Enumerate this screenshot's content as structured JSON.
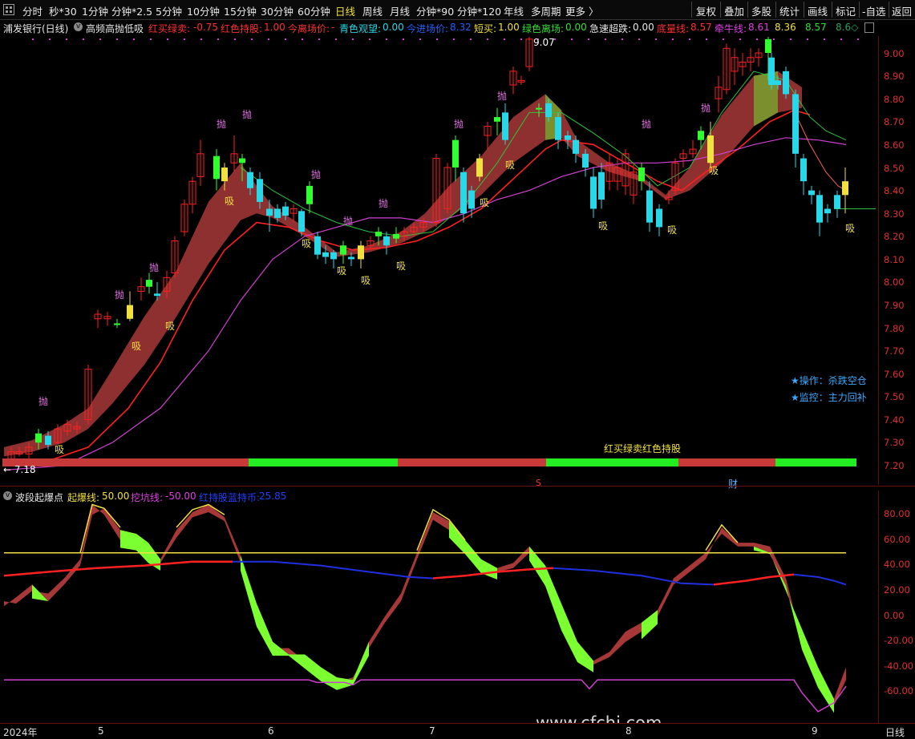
{
  "toolbar": {
    "periods": [
      "分时",
      "秒*30",
      "1分钟",
      "分钟*2.5",
      "5分钟",
      "10分钟",
      "15分钟",
      "30分钟",
      "60分钟",
      "日线",
      "周线",
      "月线",
      "分钟*90",
      "分钟*120",
      "年线",
      "多周期",
      "更多 〉"
    ],
    "active_period": "日线",
    "right_buttons": [
      "复权",
      "叠加",
      "多股",
      "统计",
      "画线",
      "标记",
      "-自选",
      "返回"
    ]
  },
  "main_info": {
    "stock": "浦发银行(日线)",
    "indicator_name": "高频高抛低吸",
    "items": [
      {
        "label": "红买绿卖:",
        "value": "-0.75",
        "color": "#ff3030"
      },
      {
        "label": "红色持股:",
        "value": "1.00",
        "color": "#ff3030"
      },
      {
        "label": "今离场价:",
        "value": "-",
        "color": "#ff3030"
      },
      {
        "label": "青色观望:",
        "value": "0.00",
        "color": "#28d8e8"
      },
      {
        "label": "今进场价:",
        "value": "8.32",
        "color": "#2060ff"
      },
      {
        "label": "短买:",
        "value": "1.00",
        "color": "#f0e040"
      },
      {
        "label": "绿色离场:",
        "value": "0.00",
        "color": "#30e030"
      },
      {
        "label": "急速超跌:",
        "value": "0.00",
        "color": "#e8e8e8"
      },
      {
        "label": "底量线:",
        "value": "8.57",
        "color": "#ff3030"
      },
      {
        "label": "牵牛线:",
        "value": "8.61",
        "color": "#e040e0"
      },
      {
        "label": "",
        "value": "8.36",
        "color": "#f0e040"
      },
      {
        "label": "",
        "value": "8.57",
        "color": "#30e030"
      },
      {
        "label": "",
        "value": "8.6◇",
        "color": "#2aa060"
      }
    ]
  },
  "price_axis": [
    "9.00",
    "8.90",
    "8.80",
    "8.70",
    "8.60",
    "8.50",
    "8.40",
    "8.30",
    "8.20",
    "8.10",
    "8.00",
    "7.90",
    "7.80",
    "7.70",
    "7.60",
    "7.50",
    "7.40",
    "7.30",
    "7.20"
  ],
  "annotations": {
    "high_marker": "9.07",
    "low_marker": "← 7.18",
    "ops": "★操作：杀跌空仓",
    "monitor": "★监控：主力回补",
    "band_label": "红买绿卖红色持股",
    "s_mark": "S",
    "cai_mark": "财",
    "throw": "抛",
    "absorb": "吸"
  },
  "ind_info": {
    "name": "波段起爆点",
    "items": [
      {
        "label": "起爆线:",
        "value": "50.00",
        "color": "#f0e040"
      },
      {
        "label": "挖坑线:",
        "value": "-50.00",
        "color": "#e040e0"
      },
      {
        "label": "红持股蓝持币:",
        "value": "25.85",
        "color": "#2040ff"
      }
    ]
  },
  "ind_axis": [
    "80.00",
    "60.00",
    "40.00",
    "20.00",
    "0.00",
    "-20.00",
    "-40.00",
    "-60.00"
  ],
  "date_axis": {
    "year": "2024年",
    "months": [
      "5",
      "6",
      "7",
      "8",
      "9"
    ],
    "period_label": "日线"
  },
  "watermark": "www.cfchi.com",
  "colors": {
    "up": "#ff3030",
    "down": "#28d8e8",
    "bull": "#ff2020",
    "bear": "#30ff30",
    "band_red": "#a83838",
    "band_green": "#7cff30"
  }
}
